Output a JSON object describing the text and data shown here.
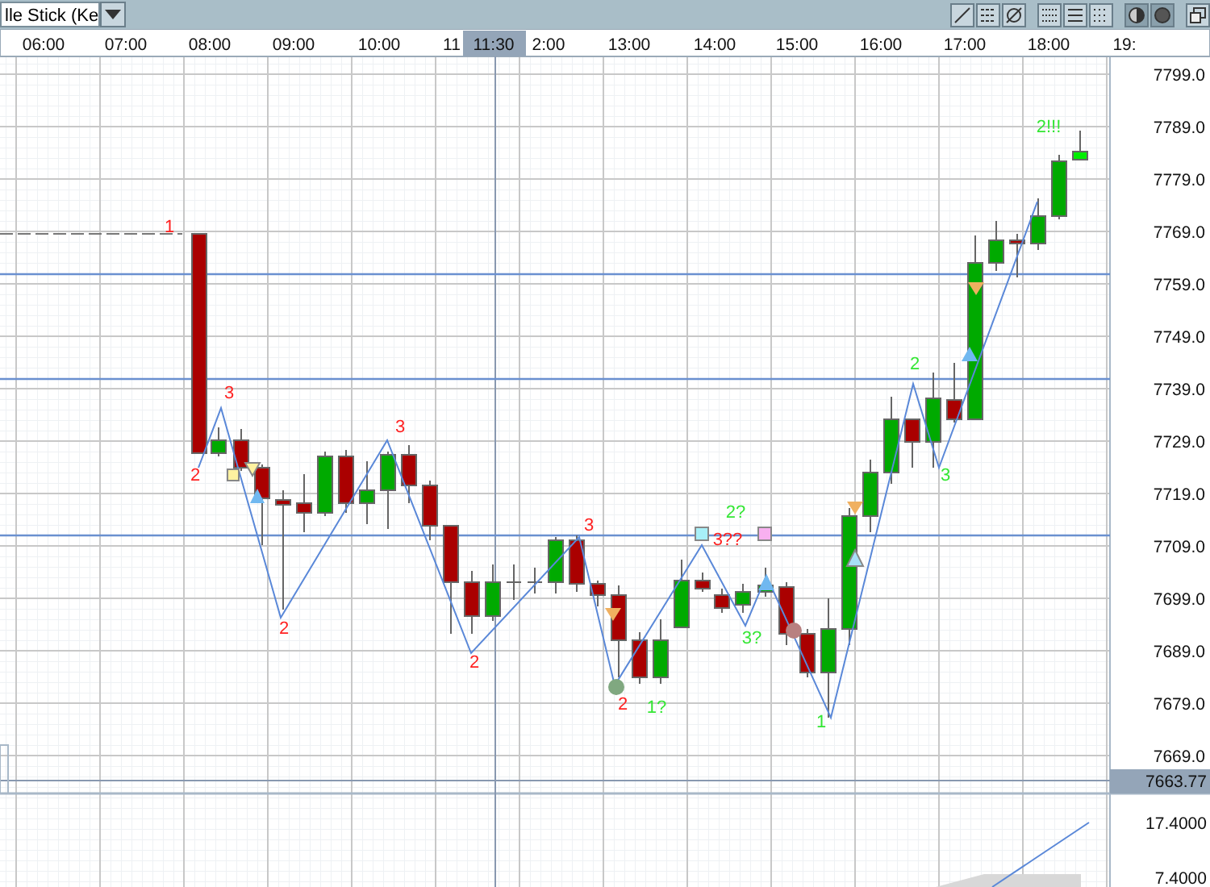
{
  "toolbar": {
    "chart_type_dropdown": {
      "value": "lle Stick (Ke"
    }
  },
  "time_axis": [
    {
      "label": "06:00",
      "kind": "tick"
    },
    {
      "label": "07:00",
      "kind": "tick"
    },
    {
      "label": "08:00",
      "kind": "tick"
    },
    {
      "label": "09:00",
      "kind": "tick"
    },
    {
      "label": "10:00",
      "kind": "tick"
    },
    {
      "label": "11",
      "kind": "tick"
    },
    {
      "label": "11:30",
      "kind": "cursor"
    },
    {
      "label": "2:00",
      "kind": "tick"
    },
    {
      "label": "13:00",
      "kind": "tick"
    },
    {
      "label": "14:00",
      "kind": "tick"
    },
    {
      "label": "15:00",
      "kind": "tick"
    },
    {
      "label": "16:00",
      "kind": "tick"
    },
    {
      "label": "17:00",
      "kind": "tick"
    },
    {
      "label": "18:00",
      "kind": "tick"
    },
    {
      "label": "19:",
      "kind": "tick"
    }
  ],
  "price_axis": [
    "7799.0",
    "7789.0",
    "7779.0",
    "7769.0",
    "7759.0",
    "7749.0",
    "7739.0",
    "7729.0",
    "7719.0",
    "7709.0",
    "7699.0",
    "7689.0",
    "7679.0",
    "7669.0"
  ],
  "cursor_price": "7663.77",
  "annotations": [
    {
      "text": "1",
      "color": "#ff2020"
    },
    {
      "text": "2",
      "color": "#ff2020"
    },
    {
      "text": "3",
      "color": "#ff2020"
    },
    {
      "text": "2",
      "color": "#ff2020"
    },
    {
      "text": "3",
      "color": "#ff2020"
    },
    {
      "text": "2",
      "color": "#ff2020"
    },
    {
      "text": "3",
      "color": "#ff2020"
    },
    {
      "text": "2",
      "color": "#ff2020"
    },
    {
      "text": "1?",
      "color": "#33e633"
    },
    {
      "text": "2?",
      "color": "#33e633"
    },
    {
      "text": "3??",
      "color": "#ff2020"
    },
    {
      "text": "3?",
      "color": "#33e633"
    },
    {
      "text": "1",
      "color": "#33e633"
    },
    {
      "text": "2",
      "color": "#33e633"
    },
    {
      "text": "3",
      "color": "#33e633"
    },
    {
      "text": "2!!!",
      "color": "#33e633"
    }
  ],
  "lower_panel_axis": [
    "17.4000",
    "7.4000"
  ]
}
